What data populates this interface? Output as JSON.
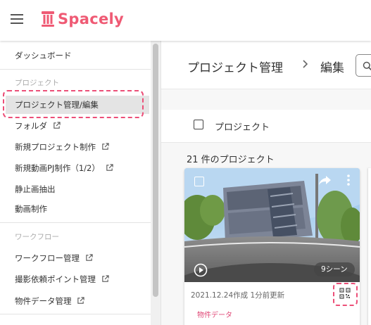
{
  "header": {
    "brand": "Spacely",
    "brand_color": "#ef5a74"
  },
  "sidebar": {
    "dashboard": "ダッシュボード",
    "section_project": "プロジェクト",
    "project_manage": "プロジェクト管理/編集",
    "folder": "フォルダ",
    "new_project": "新規プロジェクト制作",
    "new_video": "新規動画PJ制作（1/2）",
    "still_extract": "静止画抽出",
    "video_make": "動画制作",
    "section_workflow": "ワークフロー",
    "workflow_manage": "ワークフロー管理",
    "shoot_points": "撮影依頼ポイント管理",
    "property_data": "物件データ管理"
  },
  "main": {
    "title": "プロジェクト管理",
    "subtitle": "編集",
    "select_label": "プロジェクト",
    "count": "21 件のプロジェクト",
    "card": {
      "scene_badge": "9シーン",
      "meta": "2021.12.24作成 1分前更新",
      "tag": "物件データ"
    }
  },
  "icons": {
    "menu": "hamburger-icon",
    "logo": "pillar-logo",
    "external": "external-link-icon",
    "search": "search-icon",
    "breadcrumb": "chevron-right-icon",
    "share": "share-icon",
    "more": "more-vertical-icon",
    "play": "play-icon",
    "qr": "qr-code-icon"
  },
  "colors": {
    "accent": "#ef5a74",
    "highlight": "#ec4f78",
    "tag": "#e04a78"
  }
}
